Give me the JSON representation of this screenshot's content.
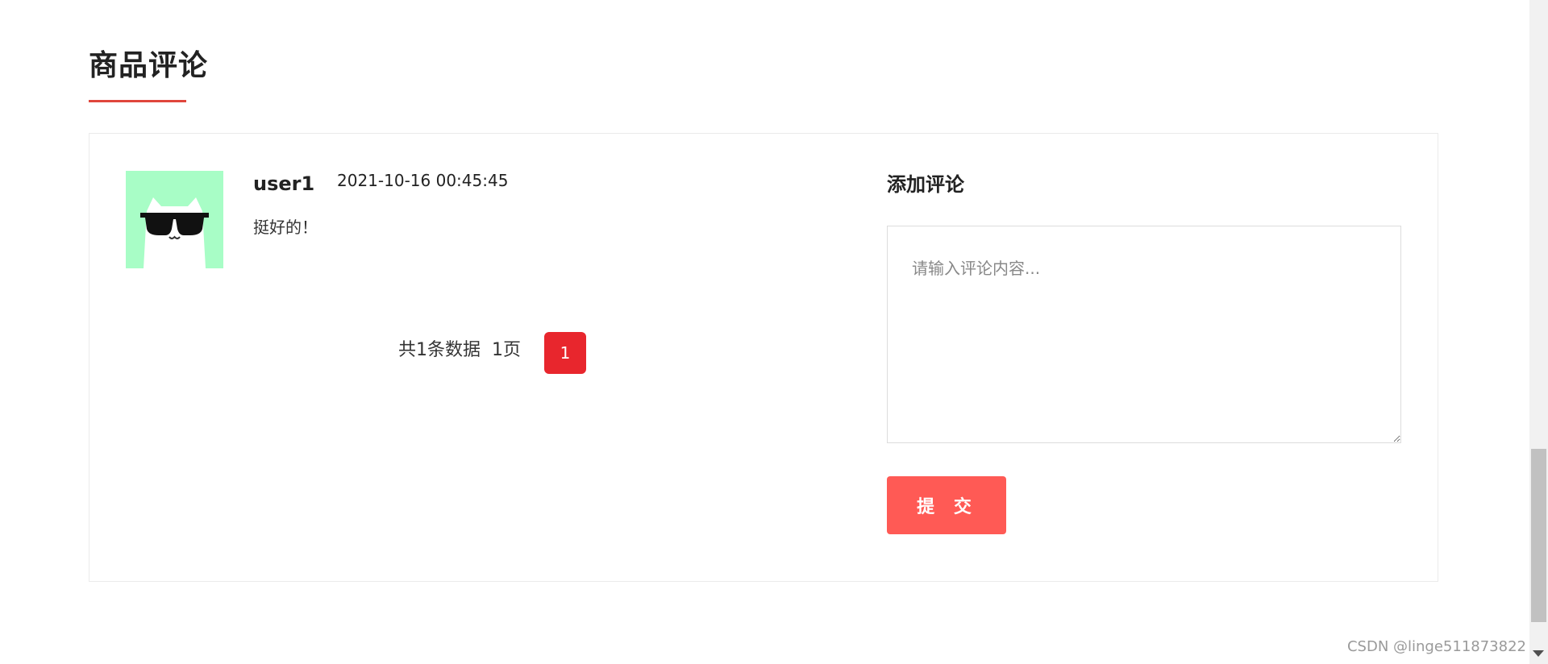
{
  "section": {
    "title": "商品评论"
  },
  "comments": [
    {
      "user": "user1",
      "time": "2021-10-16 00:45:45",
      "text": "挺好的！",
      "avatar_icon": "cat-sunglasses-icon",
      "avatar_bg": "#a8fdc6"
    }
  ],
  "pagination": {
    "total_text": "共1条数据",
    "pages_text": "1页",
    "current_page": "1",
    "active_color": "#e8262d"
  },
  "add_comment": {
    "title": "添加评论",
    "placeholder": "请输入评论内容...",
    "value": "",
    "submit_label": "提 交",
    "submit_color": "#ff5a55"
  },
  "watermark": "CSDN @linge511873822",
  "theme": {
    "accent": "#e0463c"
  }
}
